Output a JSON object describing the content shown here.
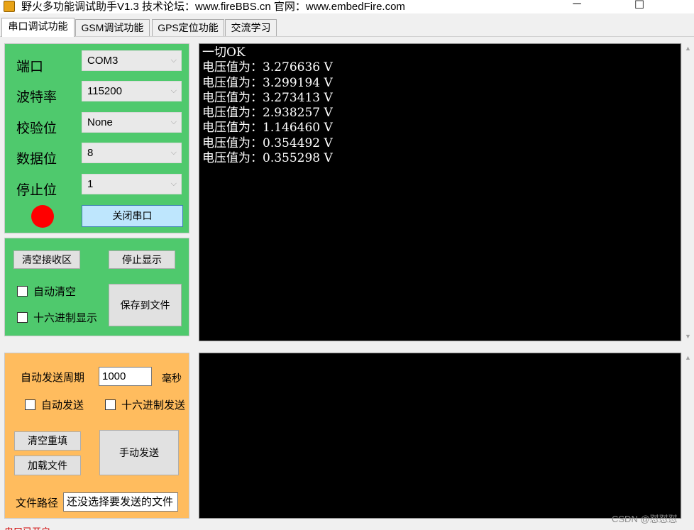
{
  "window": {
    "title": "野火多功能调试助手V1.3    技术论坛：www.fireBBS.cn  官网：www.embedFire.com",
    "minimize": "─",
    "maximize": "☐",
    "close": "✕"
  },
  "tabs": [
    "串口调试功能",
    "GSM调试功能",
    "GPS定位功能",
    "交流学习"
  ],
  "serial": {
    "port_label": "端口",
    "port_value": "COM3",
    "baud_label": "波特率",
    "baud_value": "115200",
    "parity_label": "校验位",
    "parity_value": "None",
    "databits_label": "数据位",
    "databits_value": "8",
    "stopbits_label": "停止位",
    "stopbits_value": "1",
    "toggle_button": "关闭串口",
    "status_color": "#ff0000"
  },
  "receive": {
    "clear_button": "清空接收区",
    "stop_button": "停止显示",
    "auto_clear": "自动清空",
    "hex_display": "十六进制显示",
    "save_button": "保存到文件"
  },
  "send": {
    "period_label": "自动发送周期",
    "period_value": "1000",
    "period_unit": "毫秒",
    "auto_send": "自动发送",
    "hex_send": "十六进制发送",
    "clear_button": "清空重填",
    "load_button": "加载文件",
    "manual_button": "手动发送",
    "path_label": "文件路径",
    "path_value": "还没选择要发送的文件"
  },
  "console": {
    "lines": [
      "一切OK",
      "电压值为：3.276636 V",
      "电压值为：3.299194 V",
      "电压值为：3.273413 V",
      "电压值为：2.938257 V",
      "电压值为：1.146460 V",
      "电压值为：0.354492 V",
      "电压值为：0.355298 V"
    ]
  },
  "statusbar": {
    "text": "串口已开启"
  },
  "watermark": "CSDN @怼怼怼",
  "colors": {
    "green_panel": "#4fc96d",
    "orange_panel": "#ffbc5e",
    "console_bg": "#000000"
  }
}
